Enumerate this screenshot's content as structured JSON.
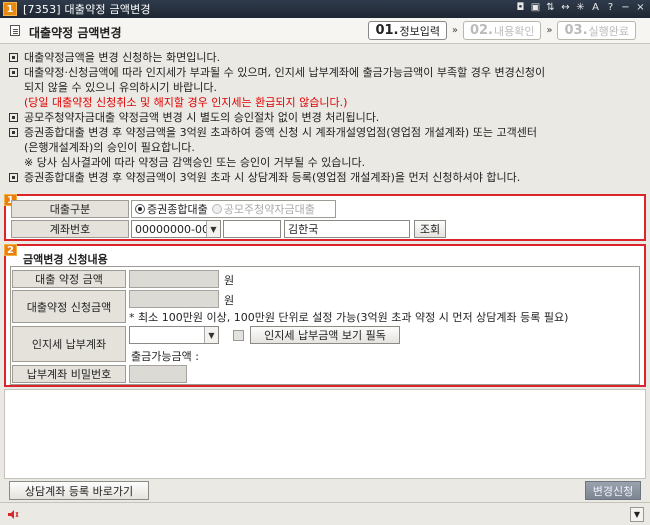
{
  "window": {
    "badge": "1",
    "title": "[7353] 대출약정 금액변경",
    "icons": [
      "◘",
      "▣",
      "⇅",
      "↔",
      "✳",
      "A",
      "?",
      "−",
      "×"
    ]
  },
  "header": {
    "title": "대출약정 금액변경",
    "steps": [
      {
        "no": "01.",
        "label": "정보입력",
        "active": true
      },
      {
        "no": "02.",
        "label": "내용확인",
        "active": false
      },
      {
        "no": "03.",
        "label": "실행완료",
        "active": false
      }
    ],
    "step_arrow": "»"
  },
  "notes": [
    {
      "text": "대출약정금액을 변경 신청하는 화면입니다.",
      "bullet": true
    },
    {
      "text": "대출약정·신청금액에 따라 인지세가 부과될 수 있으며, 인지세 납부계좌에 출금가능금액이 부족할 경우 변경신청이",
      "bullet": true
    },
    {
      "text": "되지 않을 수 있으니 유의하시기 바랍니다.",
      "bullet": false
    },
    {
      "text": "(당일 대출약정 신청취소 및 해지할 경우 인지세는 환급되지 않습니다.)",
      "bullet": false,
      "red": true
    },
    {
      "text": "공모주청약자금대출 약정금액 변경 시 별도의 승인절차 없이 변경 처리됩니다.",
      "bullet": true
    },
    {
      "text": "증권종합대출 변경 후 약정금액을 3억원 초과하여 증액 신청 시 계좌개설영업점(영업점 개설계좌) 또는 고객센터",
      "bullet": true
    },
    {
      "text": "(은행개설계좌)의 승인이 필요합니다.",
      "bullet": false
    },
    {
      "text": "※ 당사 심사결과에 따라 약정금 감액승인 또는 승인이 거부될 수 있습니다.",
      "bullet": false
    },
    {
      "text": "증권종합대출 변경 후 약정금액이 3억원 초과 시 상담계좌 등록(영업점 개설계좌)을 먼저 신청하셔야 합니다.",
      "bullet": true
    }
  ],
  "section1": {
    "badge": "1",
    "loan_type_label": "대출구분",
    "loan_options": [
      {
        "label": "증권종합대출",
        "selected": true,
        "disabled": false
      },
      {
        "label": "공모주청약자금대출",
        "selected": false,
        "disabled": true
      }
    ],
    "account_label": "계좌번호",
    "account_value": "00000000-00",
    "account_pw_value": "",
    "holder_name": "김한국",
    "query_button": "조회"
  },
  "section2": {
    "badge": "2",
    "title": "금액변경 신청내용",
    "loan_amount_label": "대출 약정 금액",
    "loan_amount_value": "",
    "unit_won": "원",
    "request_amount_label": "대출약정 신청금액",
    "request_amount_value": "",
    "request_hint": "* 최소 100만원 이상, 100만원 단위로 설정 가능(3억원 초과 약정 시 먼저 상담계좌 등록 필요)",
    "stamp_tax_label": "인지세 납부계좌",
    "stamp_tax_account": "",
    "stamp_tax_check_label": "인지세 납부금액 보기 필독",
    "withdrawable_label": "출금가능금액 :",
    "withdrawable_value": "",
    "pw_label": "납부계좌 비밀번호",
    "pw_value": ""
  },
  "footer": {
    "consult_button": "상담계좌 등록 바로가기",
    "submit_button": "변경신청"
  },
  "status_bar": {
    "message": ""
  }
}
